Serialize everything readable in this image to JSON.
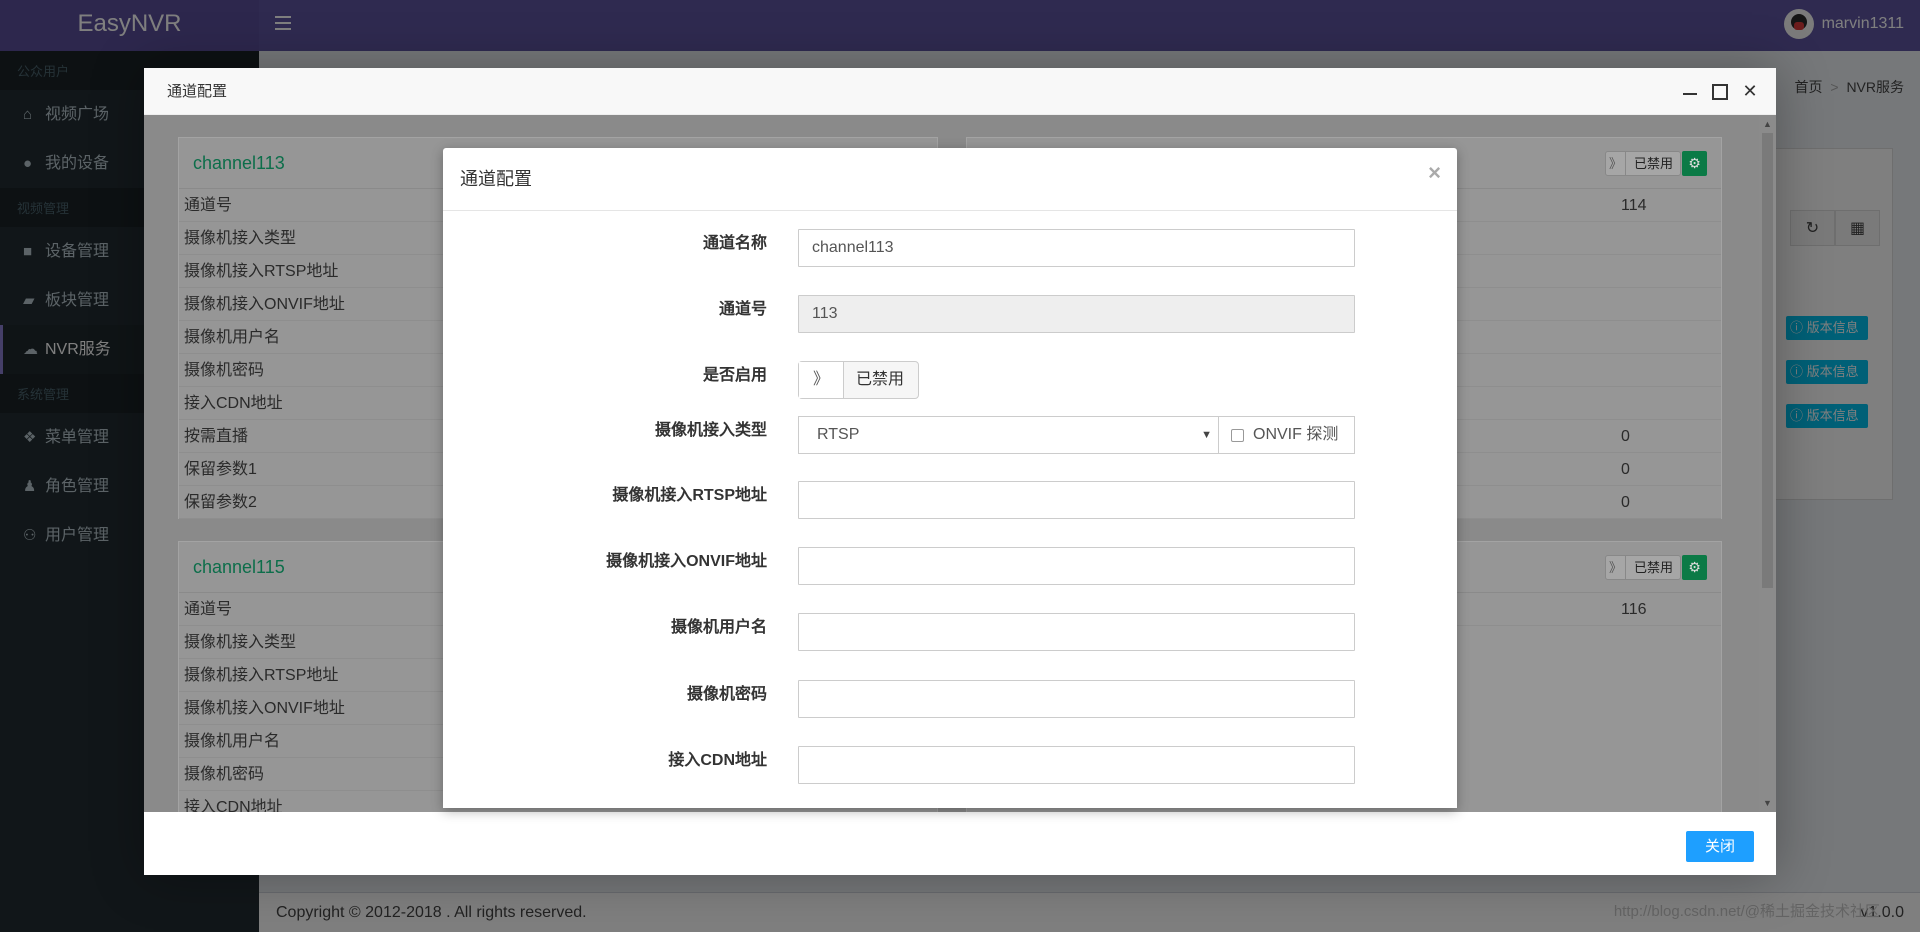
{
  "app": {
    "logo": "EasyNVR",
    "username": "marvin1311"
  },
  "sidebar": {
    "sections": [
      {
        "header": "公众用户",
        "items": [
          {
            "icon": "home-icon",
            "label": "视频广场"
          },
          {
            "icon": "user-icon",
            "label": "我的设备"
          }
        ]
      },
      {
        "header": "视频管理",
        "items": [
          {
            "icon": "video-camera-icon",
            "label": "设备管理"
          },
          {
            "icon": "folder-icon",
            "label": "板块管理"
          },
          {
            "icon": "cloud-icon",
            "label": "NVR服务",
            "active": true
          }
        ]
      },
      {
        "header": "系统管理",
        "items": [
          {
            "icon": "cubes-icon",
            "label": "菜单管理"
          },
          {
            "icon": "role-icon",
            "label": "角色管理"
          },
          {
            "icon": "users-icon",
            "label": "用户管理"
          }
        ]
      }
    ]
  },
  "breadcrumb": {
    "home": "首页",
    "separator": ">",
    "current": "NVR服务"
  },
  "background_page": {
    "version_button": "版本信息",
    "footer": "Copyright © 2012-2018 . All rights reserved.",
    "footer_version": "v1.0.0",
    "watermark": "http://blog.csdn.net/@稀土掘金技术社区"
  },
  "layer": {
    "title": "通道配置",
    "close_label": "关闭",
    "panels": [
      {
        "name": "channel113",
        "toggle_label": "已禁用",
        "rows": [
          {
            "label": "通道号",
            "value": ""
          },
          {
            "label": "摄像机接入类型",
            "value": ""
          },
          {
            "label": "摄像机接入RTSP地址",
            "value": ""
          },
          {
            "label": "摄像机接入ONVIF地址",
            "value": ""
          },
          {
            "label": "摄像机用户名",
            "value": ""
          },
          {
            "label": "摄像机密码",
            "value": ""
          },
          {
            "label": "接入CDN地址",
            "value": ""
          },
          {
            "label": "按需直播",
            "value": ""
          },
          {
            "label": "保留参数1",
            "value": ""
          },
          {
            "label": "保留参数2",
            "value": ""
          }
        ]
      },
      {
        "name": "",
        "toggle_label": "已禁用",
        "rows": [
          {
            "label": "",
            "value": "114"
          },
          {
            "label": "",
            "value": ""
          },
          {
            "label": "",
            "value": ""
          },
          {
            "label": "",
            "value": ""
          },
          {
            "label": "",
            "value": ""
          },
          {
            "label": "",
            "value": ""
          },
          {
            "label": "",
            "value": ""
          },
          {
            "label": "",
            "value": "0"
          },
          {
            "label": "",
            "value": "0"
          },
          {
            "label": "",
            "value": "0"
          }
        ]
      },
      {
        "name": "channel115",
        "toggle_label": "已禁用",
        "rows": [
          {
            "label": "通道号",
            "value": ""
          },
          {
            "label": "摄像机接入类型",
            "value": ""
          },
          {
            "label": "摄像机接入RTSP地址",
            "value": ""
          },
          {
            "label": "摄像机接入ONVIF地址",
            "value": ""
          },
          {
            "label": "摄像机用户名",
            "value": ""
          },
          {
            "label": "摄像机密码",
            "value": ""
          },
          {
            "label": "接入CDN地址",
            "value": ""
          }
        ]
      },
      {
        "name": "",
        "toggle_label": "已禁用",
        "rows": [
          {
            "label": "",
            "value": "116"
          }
        ]
      }
    ]
  },
  "modal": {
    "title": "通道配置",
    "close_symbol": "×",
    "fields": {
      "name_label": "通道名称",
      "name_value": "channel113",
      "number_label": "通道号",
      "number_value": "113",
      "enabled_label": "是否启用",
      "enabled_toggle_icon": "》",
      "enabled_value": "已禁用",
      "type_label": "摄像机接入类型",
      "type_value": "RTSP",
      "onvif_probe_label": "ONVIF 探测",
      "rtsp_label": "摄像机接入RTSP地址",
      "rtsp_value": "",
      "onvif_label": "摄像机接入ONVIF地址",
      "onvif_value": "",
      "user_label": "摄像机用户名",
      "user_value": "",
      "password_label": "摄像机密码",
      "password_value": "",
      "cdn_label": "接入CDN地址",
      "cdn_value": ""
    }
  }
}
